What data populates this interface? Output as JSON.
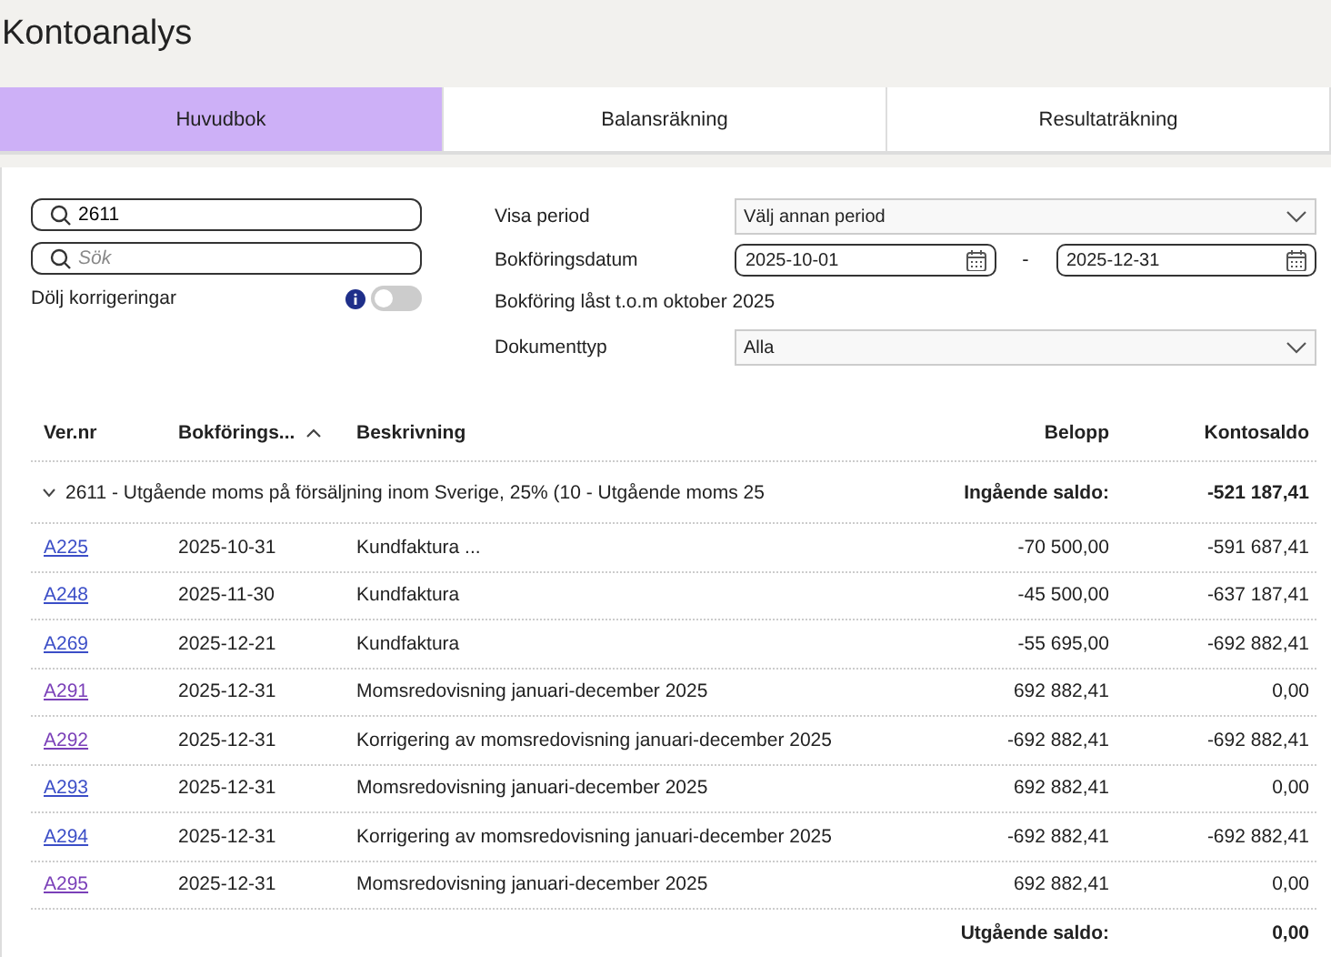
{
  "page_title": "Kontoanalys",
  "tabs": [
    {
      "label": "Huvudbok",
      "selected": true
    },
    {
      "label": "Balansräkning",
      "selected": false
    },
    {
      "label": "Resultaträkning",
      "selected": false
    }
  ],
  "search_fields": [
    {
      "value": "2611"
    },
    {
      "placeholder": "Sök"
    }
  ],
  "hide_corrections": {
    "label": "Dölj korrigeringar",
    "on": false
  },
  "filters": {
    "period_label": "Visa period",
    "period_value": "Välj annan period",
    "date_label": "Bokföringsdatum",
    "date_from": "2025-10-01",
    "date_separator": "-",
    "date_to": "2025-12-31",
    "locked_note": "Bokföring låst t.o.m oktober 2025",
    "doctype_label": "Dokumenttyp",
    "doctype_value": "Alla"
  },
  "table": {
    "columns": [
      {
        "label": "Ver.nr",
        "sorted": false
      },
      {
        "label": "Bokförings...",
        "sorted": true
      },
      {
        "label": "Beskrivning",
        "sorted": false
      },
      {
        "label": "Belopp",
        "sorted": false
      },
      {
        "label": "Kontosaldo",
        "sorted": false
      }
    ],
    "group": {
      "label": "2611 - Utgående moms på försäljning inom Sverige, 25% (10 - Utgående moms 25",
      "expanded": true,
      "opening_label": "Ingående saldo:",
      "opening_value": "-521 187,41"
    },
    "rows": [
      {
        "ver": "A225",
        "visited": false,
        "date": "2025-10-31",
        "description": "Kundfaktura ...",
        "amount": "-70 500,00",
        "balance": "-591 687,41"
      },
      {
        "ver": "A248",
        "visited": false,
        "date": "2025-11-30",
        "description": "Kundfaktura",
        "amount": "-45 500,00",
        "balance": "-637 187,41"
      },
      {
        "ver": "A269",
        "visited": false,
        "date": "2025-12-21",
        "description": "Kundfaktura",
        "amount": "-55 695,00",
        "balance": "-692 882,41"
      },
      {
        "ver": "A291",
        "visited": true,
        "date": "2025-12-31",
        "description": "Momsredovisning januari-december 2025",
        "amount": "692 882,41",
        "balance": "0,00"
      },
      {
        "ver": "A292",
        "visited": true,
        "date": "2025-12-31",
        "description": "Korrigering av momsredovisning januari-december 2025",
        "amount": "-692 882,41",
        "balance": "-692 882,41"
      },
      {
        "ver": "A293",
        "visited": false,
        "date": "2025-12-31",
        "description": "Momsredovisning januari-december 2025",
        "amount": "692 882,41",
        "balance": "0,00"
      },
      {
        "ver": "A294",
        "visited": false,
        "date": "2025-12-31",
        "description": "Korrigering av momsredovisning januari-december 2025",
        "amount": "-692 882,41",
        "balance": "-692 882,41"
      },
      {
        "ver": "A295",
        "visited": true,
        "date": "2025-12-31",
        "description": "Momsredovisning januari-december 2025",
        "amount": "692 882,41",
        "balance": "0,00"
      }
    ],
    "closing_label": "Utgående saldo:",
    "closing_value": "0,00"
  }
}
